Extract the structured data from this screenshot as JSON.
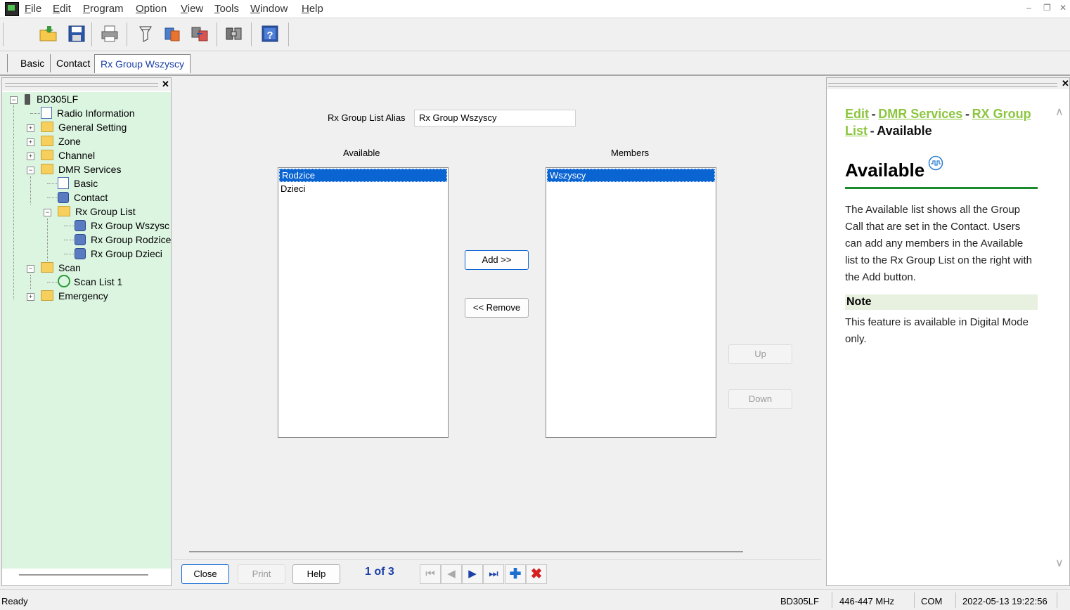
{
  "menu": {
    "items": [
      {
        "label": "File",
        "ul": "F"
      },
      {
        "label": "Edit",
        "ul": "E"
      },
      {
        "label": "Program",
        "ul": "P"
      },
      {
        "label": "Option",
        "ul": "O"
      },
      {
        "label": "View",
        "ul": "V"
      },
      {
        "label": "Tools",
        "ul": "T"
      },
      {
        "label": "Window",
        "ul": "W"
      },
      {
        "label": "Help",
        "ul": "H"
      }
    ]
  },
  "tabs": [
    "Basic",
    "Contact",
    "Rx Group Wszyscy"
  ],
  "tree": {
    "root": "BD305LF",
    "nodes": [
      "Radio Information",
      "General Setting",
      "Zone",
      "Channel",
      "DMR Services",
      "Basic",
      "Contact",
      "Rx Group List",
      "Rx Group Wszysc",
      "Rx Group Rodzice",
      "Rx Group Dzieci",
      "Scan",
      "Scan List 1",
      "Emergency"
    ]
  },
  "form": {
    "alias_label": "Rx Group List Alias",
    "alias_value": "Rx Group Wszyscy",
    "available_label": "Available",
    "members_label": "Members",
    "available_items": [
      "Rodzice",
      "Dzieci"
    ],
    "member_items": [
      "Wszyscy"
    ],
    "add_button": "Add >>",
    "remove_button": "<< Remove",
    "up_button": "Up",
    "down_button": "Down"
  },
  "bottom": {
    "close": "Close",
    "print": "Print",
    "help": "Help",
    "page": "1 of 3"
  },
  "help": {
    "crumb_1": "Edit",
    "crumb_2": "DMR Services",
    "crumb_3": "RX Group List",
    "crumb_current": "Available",
    "title": "Available",
    "description": "The Available list shows all the Group Call that are set in the Contact. Users can add any members in the Available list to the Rx Group List on the right with the Add button.",
    "note_heading": "Note",
    "note_text": "This feature is available in Digital Mode only."
  },
  "status": {
    "ready": "Ready",
    "model": "BD305LF",
    "band": "446-447 MHz",
    "port": "COM",
    "datetime": "2022-05-13 19:22:56"
  },
  "colors": {
    "tree_bg": "#dcf5e1",
    "selection": "#0a64d2",
    "link_green": "#8cc63f",
    "tab_active_text": "#1a3fa8"
  }
}
